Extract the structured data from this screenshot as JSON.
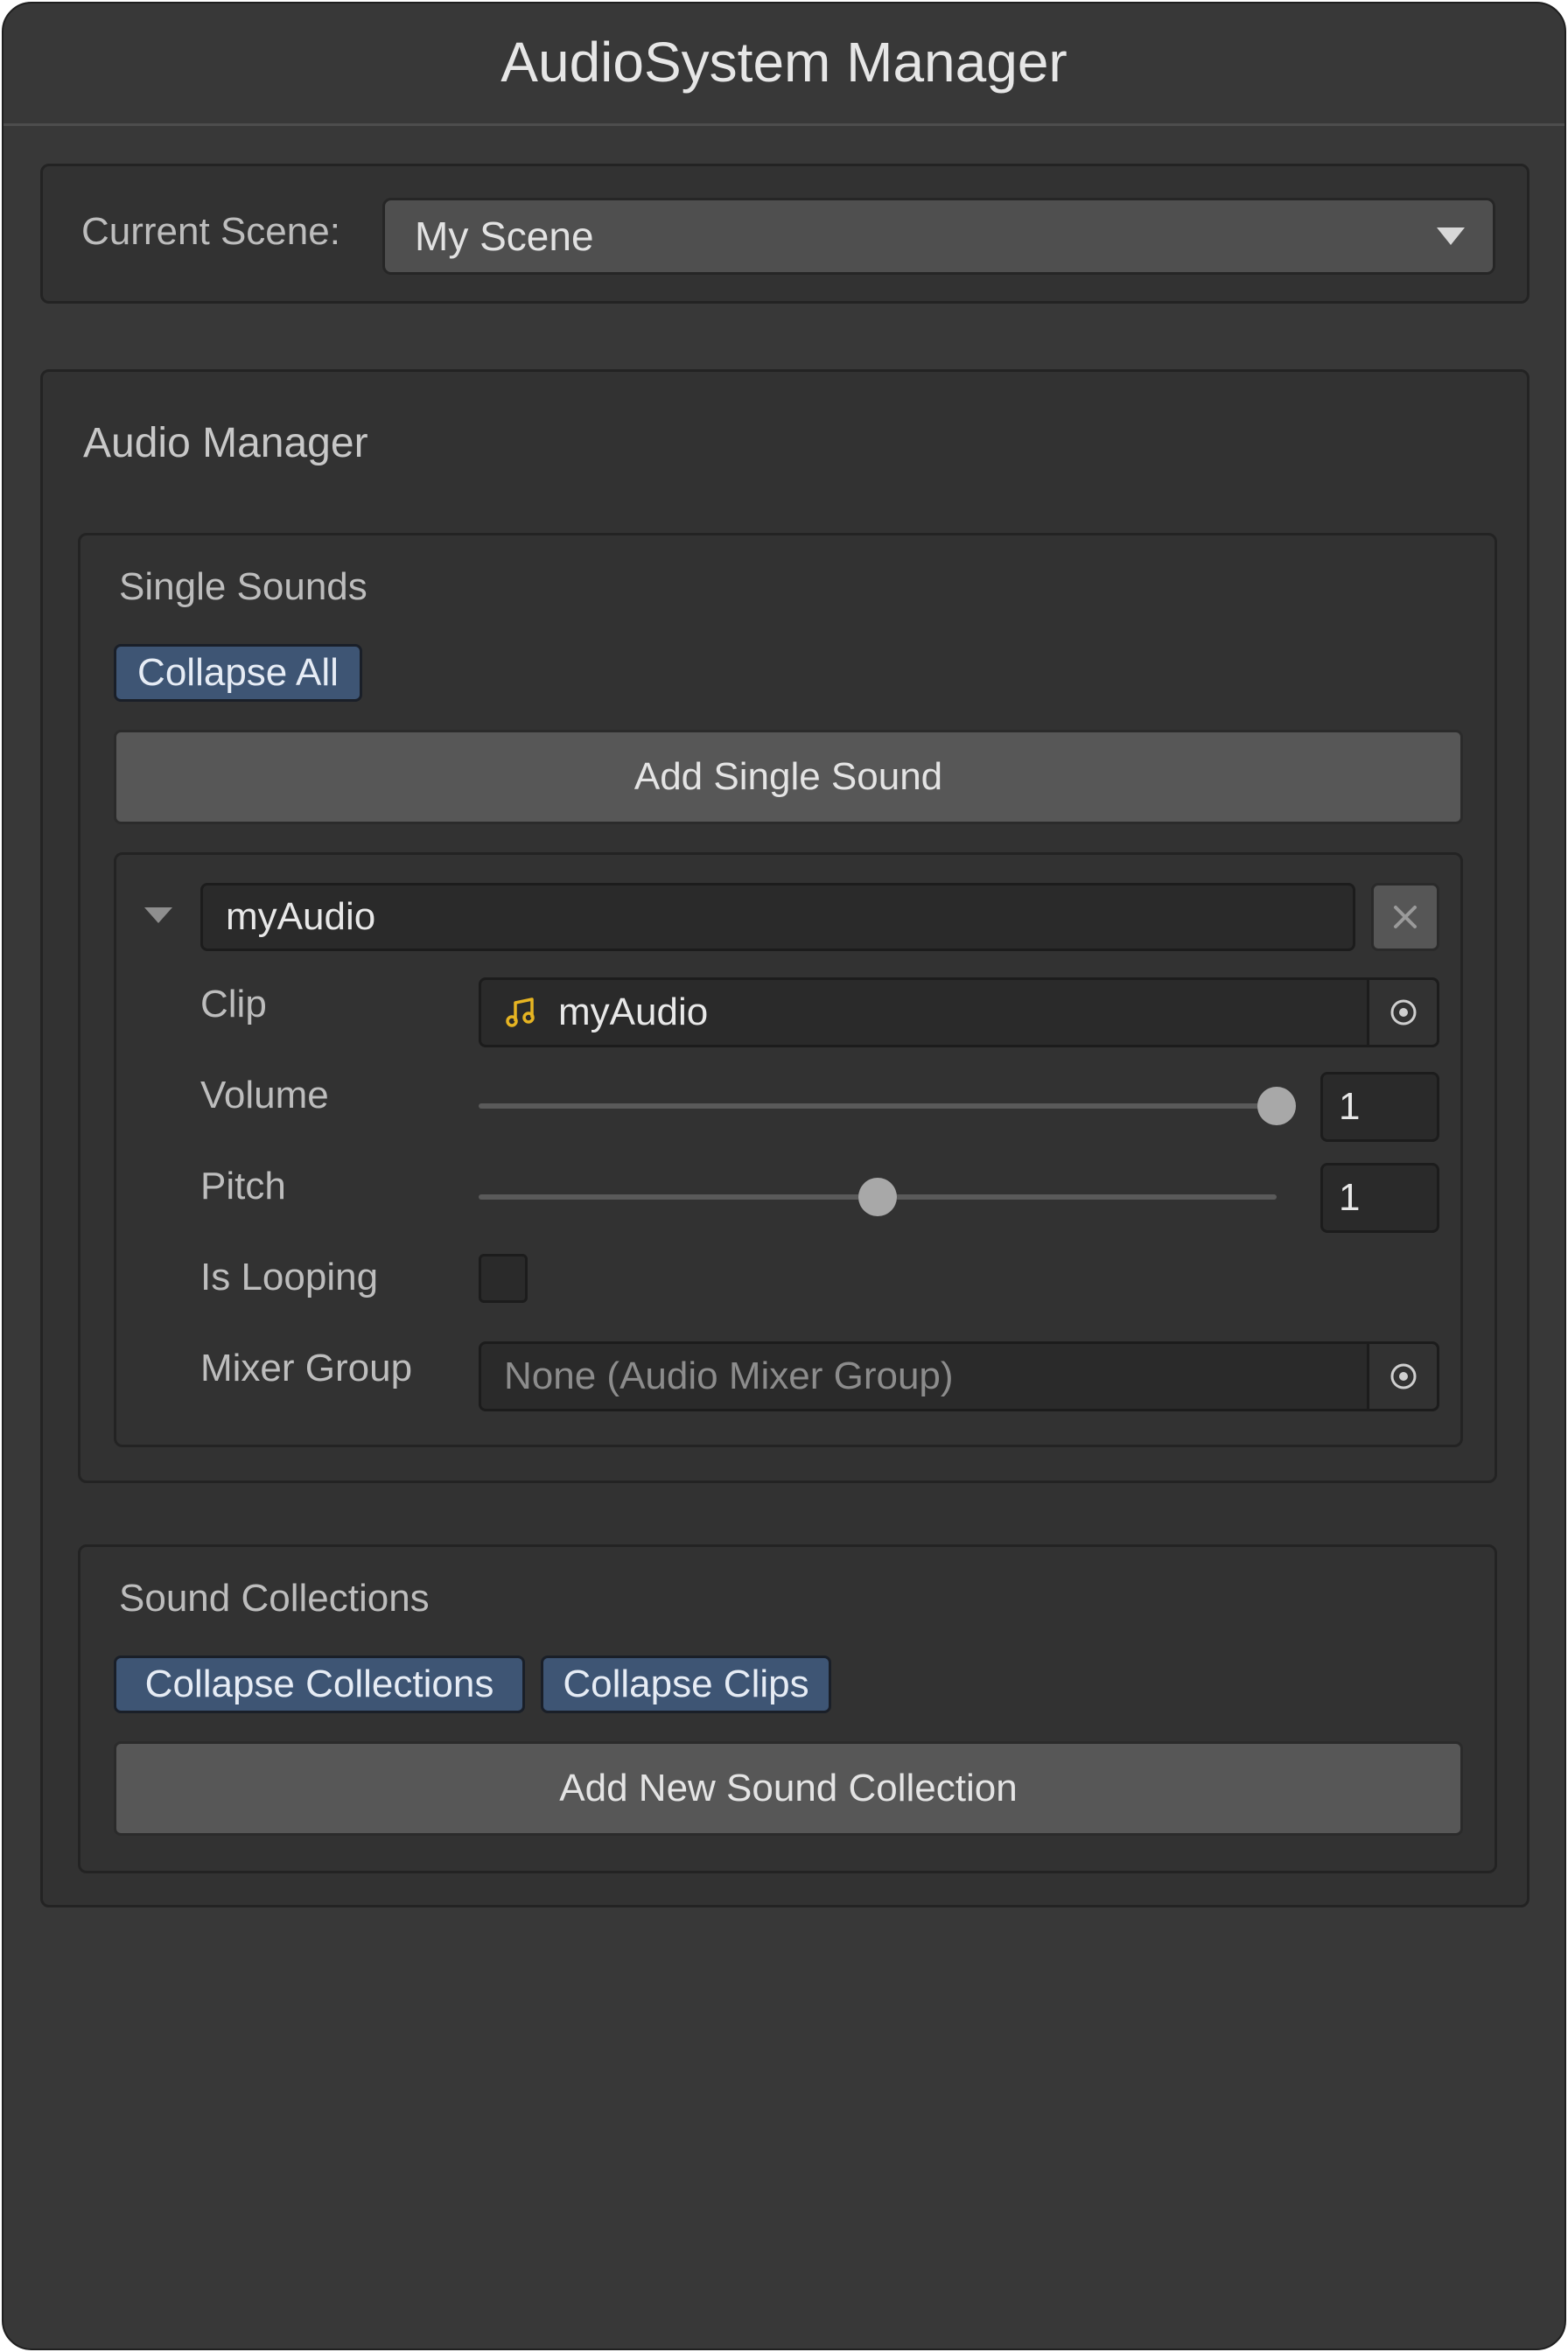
{
  "window": {
    "title": "AudioSystem Manager"
  },
  "scene": {
    "label": "Current Scene:",
    "selected": "My Scene"
  },
  "audio_manager": {
    "title": "Audio Manager",
    "single_sounds": {
      "title": "Single Sounds",
      "collapse_all_label": "Collapse All",
      "add_label": "Add Single Sound",
      "item": {
        "name": "myAudio",
        "clip_label": "Clip",
        "clip_value": "myAudio",
        "volume_label": "Volume",
        "volume_value": "1",
        "volume_fraction": 1.0,
        "pitch_label": "Pitch",
        "pitch_value": "1",
        "pitch_fraction": 0.5,
        "looping_label": "Is Looping",
        "looping_checked": false,
        "mixer_label": "Mixer Group",
        "mixer_value": "None (Audio Mixer Group)"
      }
    },
    "sound_collections": {
      "title": "Sound Collections",
      "collapse_collections_label": "Collapse Collections",
      "collapse_clips_label": "Collapse Clips",
      "add_label": "Add New Sound Collection"
    }
  },
  "colors": {
    "background": "#383838",
    "accent_chip": "#3e5574",
    "audio_icon": "#e6b422"
  },
  "icons": {
    "dropdown": "chevron-down-icon",
    "remove": "close-icon",
    "foldout": "foldout-triangle-icon",
    "clip": "music-note-icon",
    "object_picker": "object-picker-icon"
  }
}
